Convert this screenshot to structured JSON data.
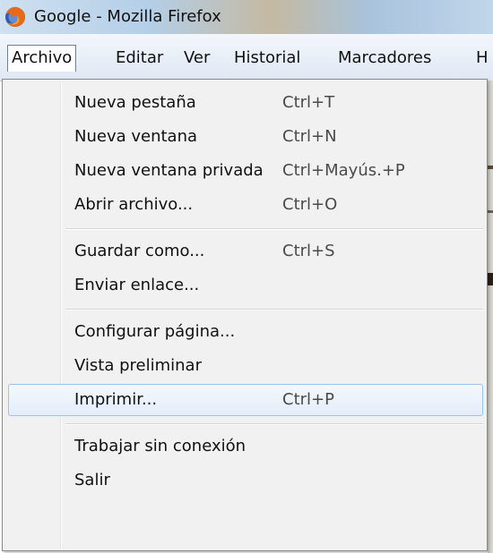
{
  "window": {
    "title": "Google - Mozilla Firefox",
    "icon": "firefox-icon"
  },
  "menubar": {
    "items": [
      {
        "label": "Archivo",
        "state": "open"
      },
      {
        "label": "Editar"
      },
      {
        "label": "Ver"
      },
      {
        "label": "Historial"
      },
      {
        "label": "Marcadores"
      },
      {
        "label": "H"
      }
    ]
  },
  "archivo_menu": {
    "groups": [
      [
        {
          "label": "Nueva pestaña",
          "shortcut": "Ctrl+T"
        },
        {
          "label": "Nueva ventana",
          "shortcut": "Ctrl+N"
        },
        {
          "label": "Nueva ventana privada",
          "shortcut": "Ctrl+Mayús.+P"
        },
        {
          "label": "Abrir archivo...",
          "shortcut": "Ctrl+O"
        }
      ],
      [
        {
          "label": "Guardar como...",
          "shortcut": "Ctrl+S"
        },
        {
          "label": "Enviar enlace..."
        }
      ],
      [
        {
          "label": "Configurar página..."
        },
        {
          "label": "Vista preliminar"
        },
        {
          "label": "Imprimir...",
          "shortcut": "Ctrl+P",
          "state": "highlighted"
        }
      ],
      [
        {
          "label": "Trabajar sin conexión"
        },
        {
          "label": "Salir"
        }
      ]
    ]
  },
  "colors": {
    "highlight_border": "#9ec2e8",
    "menu_background": "#f1f1f1"
  }
}
